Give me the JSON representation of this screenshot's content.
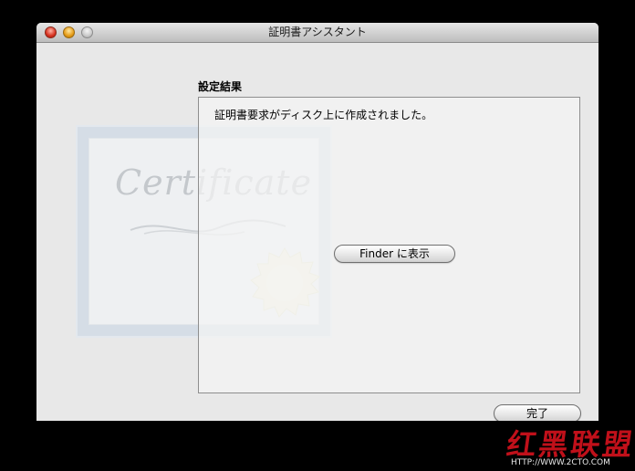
{
  "window": {
    "title": "証明書アシスタント"
  },
  "content": {
    "section_label": "設定結果",
    "result_message": "証明書要求がディスク上に作成されました。",
    "finder_button_label": "Finder に表示",
    "done_button_label": "完了",
    "cert_art_word": "Certificate"
  },
  "watermark": {
    "chars": "红黑联盟",
    "url": "HTTP://WWW.2CTO.COM"
  },
  "colors": {
    "desktop": "#000000",
    "window_bg": "#e8e8e8",
    "close": "#d6311f",
    "minimize": "#e59b16",
    "zoom": "#c9c9c9",
    "watermark_red": "#c0101a"
  }
}
